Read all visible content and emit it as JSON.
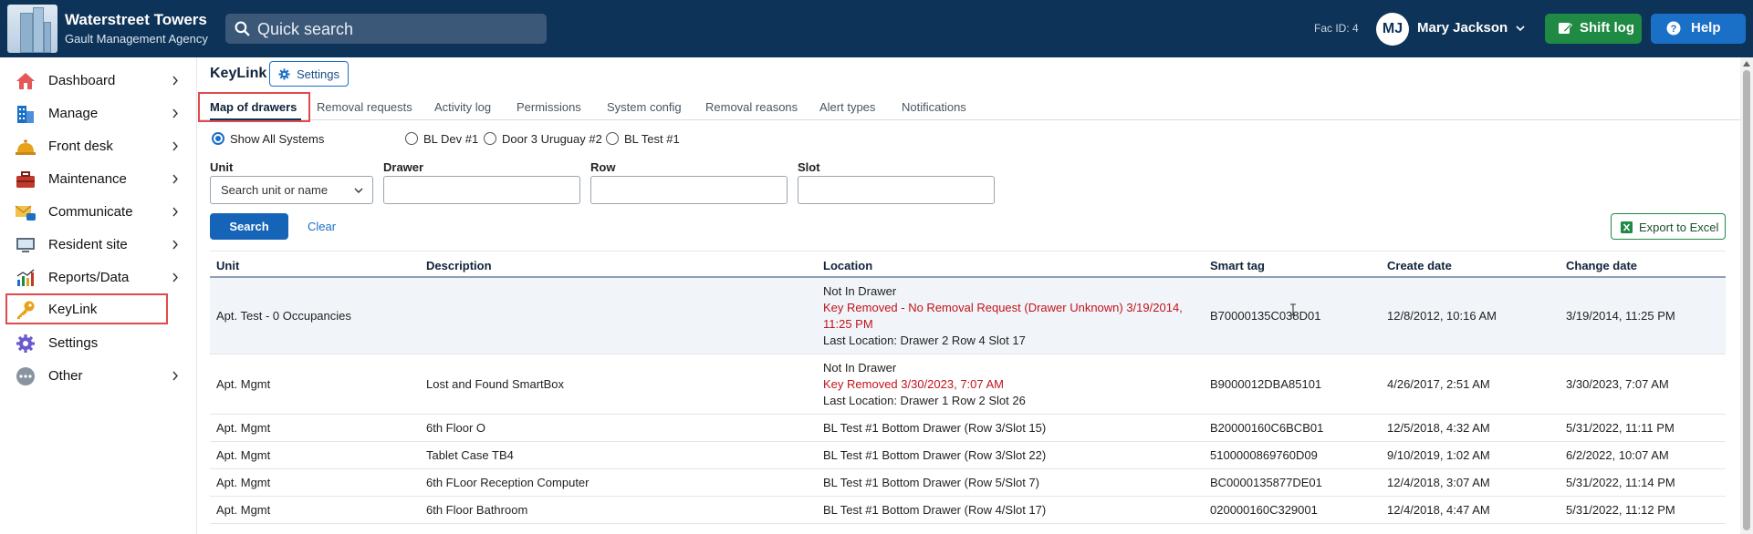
{
  "header": {
    "brand_title": "Waterstreet Towers",
    "brand_subtitle": "Gault Management Agency",
    "search_placeholder": "Quick search",
    "fac_id": "Fac ID: 4",
    "user_initials": "MJ",
    "user_name": "Mary Jackson",
    "shift_log_label": "Shift log",
    "help_label": "Help"
  },
  "sidebar": {
    "items": [
      {
        "label": "Dashboard",
        "icon": "house-icon"
      },
      {
        "label": "Manage",
        "icon": "building-icon"
      },
      {
        "label": "Front desk",
        "icon": "bell-icon"
      },
      {
        "label": "Maintenance",
        "icon": "toolbox-icon"
      },
      {
        "label": "Communicate",
        "icon": "mail-icon"
      },
      {
        "label": "Resident site",
        "icon": "monitor-icon"
      },
      {
        "label": "Reports/Data",
        "icon": "chart-icon"
      },
      {
        "label": "KeyLink",
        "icon": "key-icon"
      },
      {
        "label": "Settings",
        "icon": "gear-icon"
      },
      {
        "label": "Other",
        "icon": "more-icon"
      }
    ],
    "active_index": 7
  },
  "page": {
    "title": "KeyLink",
    "settings_label": "Settings",
    "tabs": [
      {
        "label": "Map of drawers"
      },
      {
        "label": "Removal requests"
      },
      {
        "label": "Activity log"
      },
      {
        "label": "Permissions"
      },
      {
        "label": "System config"
      },
      {
        "label": "Removal reasons"
      },
      {
        "label": "Alert types"
      },
      {
        "label": "Notifications"
      }
    ],
    "active_tab": 0
  },
  "filters": {
    "systems": [
      {
        "label": "Show All Systems",
        "selected": true
      },
      {
        "label": "BL Dev #1",
        "selected": false
      },
      {
        "label": "Door 3 Uruguay #2",
        "selected": false
      },
      {
        "label": "BL Test #1",
        "selected": false
      }
    ],
    "unit_label": "Unit",
    "unit_placeholder": "Search unit or name",
    "drawer_label": "Drawer",
    "drawer_value": "",
    "row_label": "Row",
    "row_value": "",
    "slot_label": "Slot",
    "slot_value": "",
    "search_label": "Search",
    "clear_label": "Clear",
    "export_label": "Export to Excel"
  },
  "table": {
    "columns": [
      "Unit",
      "Description",
      "Location",
      "Smart tag",
      "Create date",
      "Change date"
    ],
    "rows": [
      {
        "unit": "Apt. Test - 0 Occupancies",
        "description": "",
        "location_1": "Not In Drawer",
        "location_2": "Key Removed - No Removal Request (Drawer Unknown) 3/19/2014, 11:25 PM",
        "location_3": "Last Location: Drawer 2 Row 4 Slot 17",
        "smart_tag": "B70000135C038D01",
        "create_date": "12/8/2012, 10:16 AM",
        "change_date": "3/19/2014, 11:25 PM"
      },
      {
        "unit": "Apt. Mgmt",
        "description": "Lost and Found SmartBox",
        "location_1": "Not In Drawer",
        "location_2": "Key Removed 3/30/2023, 7:07 AM",
        "location_3": "Last Location: Drawer 1 Row 2 Slot 26",
        "smart_tag": "B9000012DBA85101",
        "create_date": "4/26/2017, 2:51 AM",
        "change_date": "3/30/2023, 7:07 AM"
      },
      {
        "unit": "Apt. Mgmt",
        "description": "6th Floor O",
        "location": "BL Test #1 Bottom Drawer (Row 3/Slot 15)",
        "smart_tag": "B20000160C6BCB01",
        "create_date": "12/5/2018, 4:32 AM",
        "change_date": "5/31/2022, 11:11 PM"
      },
      {
        "unit": "Apt. Mgmt",
        "description": "Tablet Case TB4",
        "location": "BL Test #1 Bottom Drawer (Row 3/Slot 22)",
        "smart_tag": "5100000869760D09",
        "create_date": "9/10/2019, 1:02 AM",
        "change_date": "6/2/2022, 10:07 AM"
      },
      {
        "unit": "Apt. Mgmt",
        "description": "6th FLoor Reception Computer",
        "location": "BL Test #1 Bottom Drawer (Row 5/Slot 7)",
        "smart_tag": "BC0000135877DE01",
        "create_date": "12/4/2018, 3:07 AM",
        "change_date": "5/31/2022, 11:14 PM"
      },
      {
        "unit": "Apt. Mgmt",
        "description": "6th Floor Bathroom",
        "location": "BL Test #1 Bottom Drawer (Row 4/Slot 17)",
        "smart_tag": "020000160C329001",
        "create_date": "12/4/2018, 4:47 AM",
        "change_date": "5/31/2022, 11:12 PM"
      }
    ]
  },
  "colors": {
    "topbar": "#0e3358",
    "shift_log": "#1f8a44",
    "help": "#1a6fc7",
    "highlight_box": "#e04a4a",
    "removed_text": "#c0141b"
  }
}
